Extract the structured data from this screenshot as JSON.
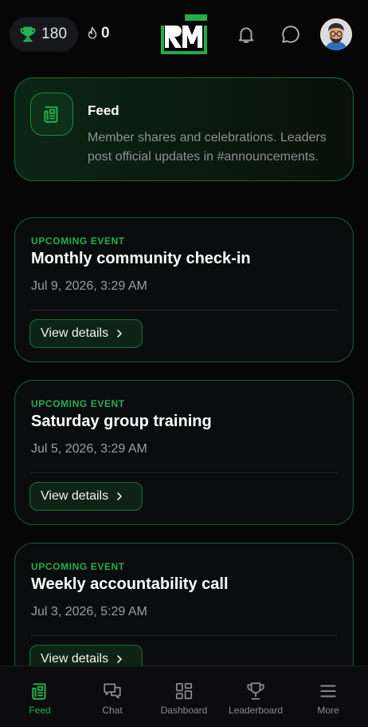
{
  "header": {
    "trophy_count": "180",
    "streak_count": "0",
    "logo_icon": "rm-logo",
    "notifications_icon": "bell-icon",
    "chat_icon": "chat-bubble-icon",
    "avatar_icon": "user-avatar"
  },
  "feed_intro": {
    "title": "Feed",
    "description": "Member shares and celebrations. Leaders post official updates in #announcements.",
    "icon": "newspaper-icon"
  },
  "events": [
    {
      "kicker": "UPCOMING EVENT",
      "title": "Monthly community check-in",
      "date": "Jul 9, 2026, 3:29 AM",
      "button": "View details"
    },
    {
      "kicker": "UPCOMING EVENT",
      "title": "Saturday group training",
      "date": "Jul 5, 2026, 3:29 AM",
      "button": "View details"
    },
    {
      "kicker": "UPCOMING EVENT",
      "title": "Weekly accountability call",
      "date": "Jul 3, 2026, 5:29 AM",
      "button": "View details"
    }
  ],
  "nav": {
    "items": [
      {
        "label": "Feed",
        "icon": "newspaper-icon",
        "active": true
      },
      {
        "label": "Chat",
        "icon": "chat-icon",
        "active": false
      },
      {
        "label": "Dashboard",
        "icon": "dashboard-icon",
        "active": false
      },
      {
        "label": "Leaderboard",
        "icon": "trophy-icon",
        "active": false
      },
      {
        "label": "More",
        "icon": "menu-icon",
        "active": false
      }
    ]
  },
  "colors": {
    "accent": "#23b14d",
    "background": "#060607",
    "card_border": "#1b5b2e",
    "muted_text": "#9c9da3"
  }
}
